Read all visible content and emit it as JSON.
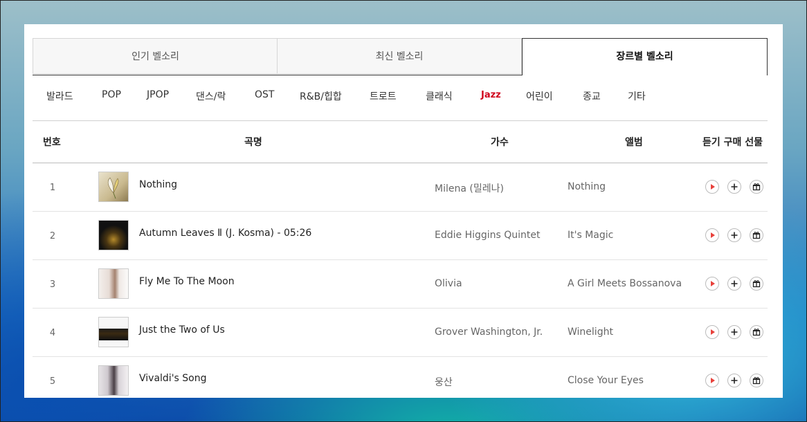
{
  "tabs": [
    {
      "label": "인기 벨소리"
    },
    {
      "label": "최신 벨소리"
    },
    {
      "label": "장르별 벨소리"
    }
  ],
  "active_tab": "장르별 벨소리",
  "genres": [
    "발라드",
    "POP",
    "JPOP",
    "댄스/락",
    "OST",
    "R&B/힙합",
    "트로트",
    "클래식",
    "Jazz",
    "어린이",
    "종교",
    "기타"
  ],
  "active_genre": "Jazz",
  "table": {
    "headers": {
      "number": "번호",
      "title": "곡명",
      "artist": "가수",
      "album": "앨범",
      "actions": "듣기 구매 선물"
    },
    "rows": [
      {
        "number": "1",
        "title": "Nothing",
        "artist": "Milena (밀레나)",
        "album": "Nothing"
      },
      {
        "number": "2",
        "title": "Autumn Leaves Ⅱ (J. Kosma) - 05:26",
        "artist": "Eddie Higgins Quintet",
        "album": "It's Magic"
      },
      {
        "number": "3",
        "title": "Fly Me To The Moon",
        "artist": "Olivia",
        "album": "A Girl Meets Bossanova"
      },
      {
        "number": "4",
        "title": "Just the Two of Us",
        "artist": "Grover Washington, Jr.",
        "album": "Winelight"
      },
      {
        "number": "5",
        "title": "Vivaldi's Song",
        "artist": "웅산",
        "album": "Close Your Eyes"
      }
    ]
  },
  "icons": {
    "listen": "play-icon",
    "buy": "plus-icon",
    "gift": "gift-icon"
  },
  "colors": {
    "accent": "#d0021b",
    "play": "#e8413b"
  }
}
